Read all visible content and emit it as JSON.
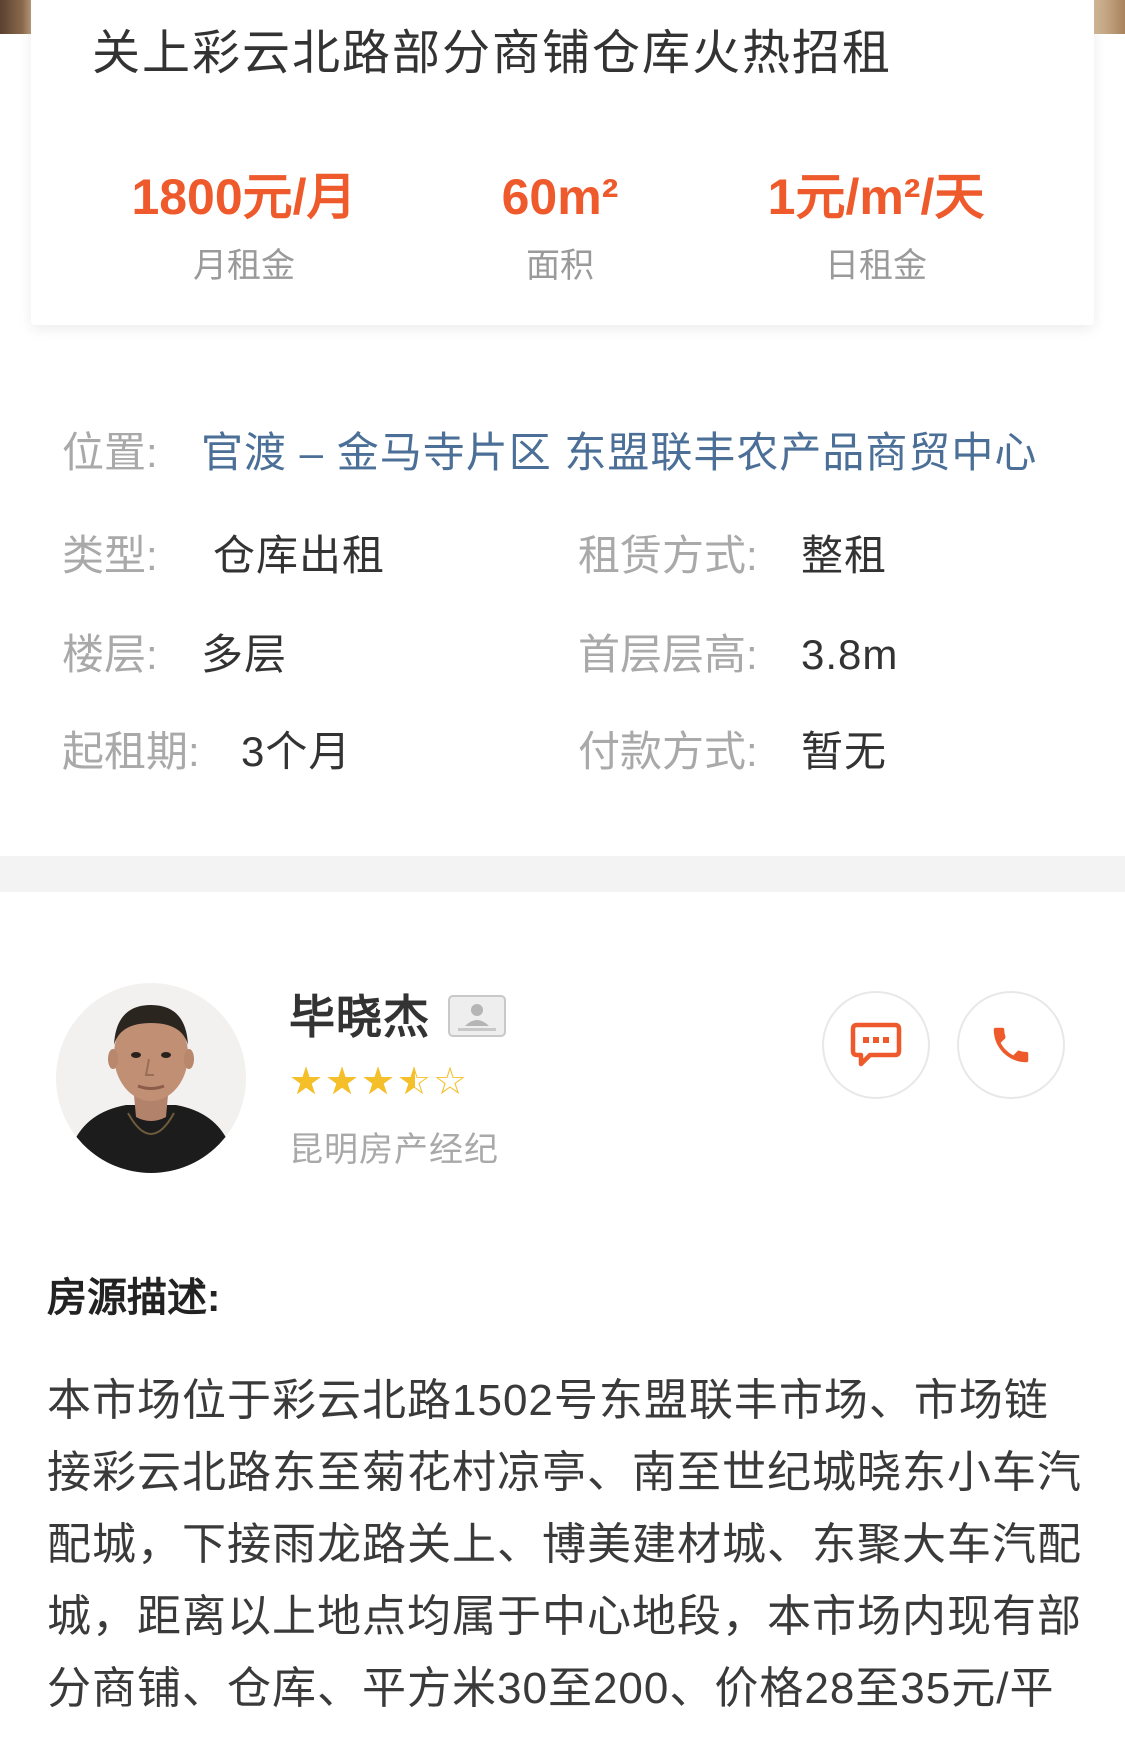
{
  "listing": {
    "title": "关上彩云北路部分商铺仓库火热招租"
  },
  "stats": [
    {
      "value": "1800元/月",
      "label": "月租金"
    },
    {
      "value": "60m²",
      "label": "面积"
    },
    {
      "value": "1元/m²/天",
      "label": "日租金"
    }
  ],
  "details": {
    "location": {
      "label": "位置:",
      "value": "官渡 – 金马寺片区 东盟联丰农产品商贸中心"
    },
    "type": {
      "label": "类型:",
      "value": "仓库出租"
    },
    "lease_mode": {
      "label": "租赁方式:",
      "value": "整租"
    },
    "floor": {
      "label": "楼层:",
      "value": "多层"
    },
    "ground_floor_height": {
      "label": "首层层高:",
      "value": "3.8m"
    },
    "min_lease": {
      "label": "起租期:",
      "value": "3个月"
    },
    "payment": {
      "label": "付款方式:",
      "value": "暂无"
    }
  },
  "agent": {
    "name": "毕晓杰",
    "rating": 3.5,
    "rating_max": 5,
    "company": "昆明房产经纪",
    "icons": {
      "badge": "id-card-icon",
      "chat": "chat-icon",
      "phone": "phone-icon",
      "star": "star-icon"
    }
  },
  "description": {
    "heading": "房源描述:",
    "lines": [
      "本市场位于彩云北路1502号东盟联丰市场、市场链",
      "接彩云北路东至菊花村凉亭、南至世纪城晓东小车汽",
      "配城，下接雨龙路关上、博美建材城、东聚大车汽配",
      "城，距离以上地点均属于中心地段，本市场内现有部",
      "分商铺、仓库、平方米30至200、价格28至35元/平"
    ]
  },
  "colors": {
    "accent": "#ee5a2c",
    "link": "#4b6f97",
    "star": "#f5bf2a",
    "label_gray": "#a9a9a9",
    "divider": "#f3f3f3"
  }
}
